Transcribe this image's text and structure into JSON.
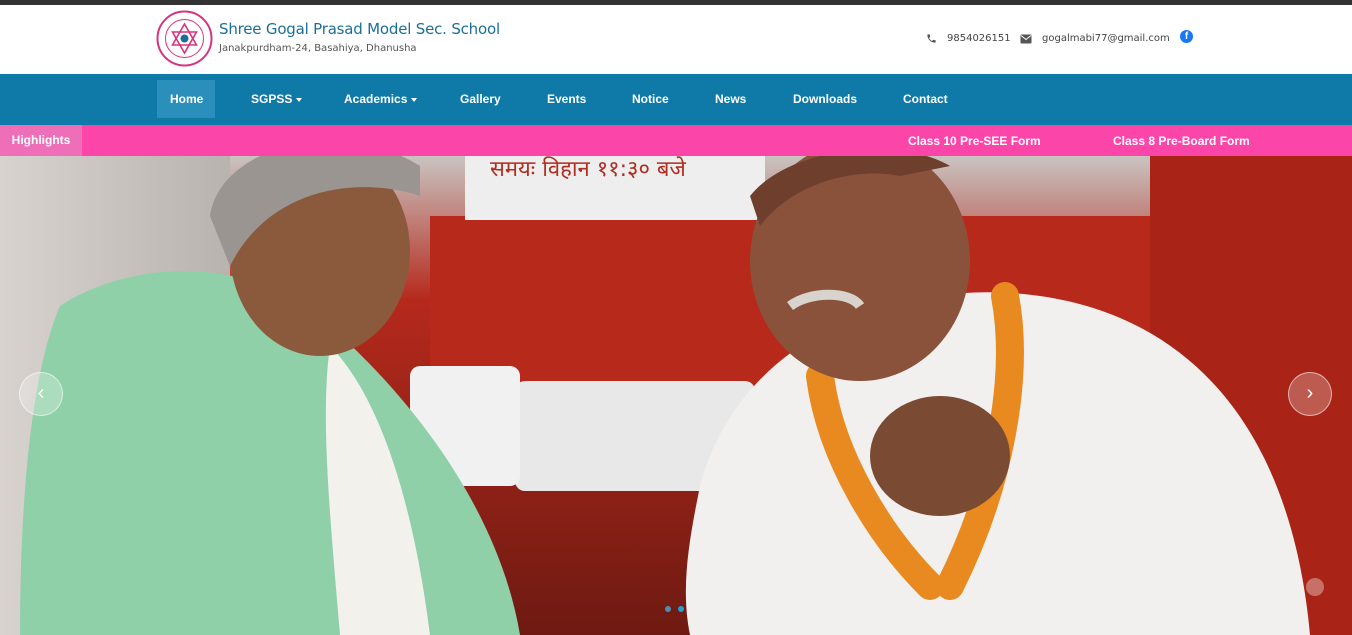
{
  "header": {
    "school_name": "Shree Gogal Prasad Model Sec. School",
    "address": "Janakpurdham-24, Basahiya, Dhanusha",
    "phone": "9854026151",
    "email": "gogalmabi77@gmail.com",
    "logo_icon": "school-emblem-icon",
    "facebook_icon": "facebook-icon"
  },
  "nav": {
    "items": [
      {
        "label": "Home"
      },
      {
        "label": "SGPSS"
      },
      {
        "label": "Academics"
      },
      {
        "label": "Gallery"
      },
      {
        "label": "Events"
      },
      {
        "label": "Notice"
      },
      {
        "label": "News"
      },
      {
        "label": "Downloads"
      },
      {
        "label": "Contact"
      }
    ]
  },
  "highlights": {
    "label": "Highlights",
    "items": [
      {
        "label": "Class 10 Pre-SEE Form"
      },
      {
        "label": "Class 8 Pre-Board Form"
      }
    ]
  },
  "slider": {
    "prev_icon": "chevron-left-icon",
    "next_icon": "chevron-right-icon",
    "banner_text": "समयः विहान ११:३० बजे",
    "active_slide": 2,
    "slide_count": 2
  },
  "colors": {
    "brand": "#0f7aa8",
    "highlight": "#fb45a8",
    "highlight_label": "#ee6fb8",
    "title": "#1a6f9a"
  }
}
